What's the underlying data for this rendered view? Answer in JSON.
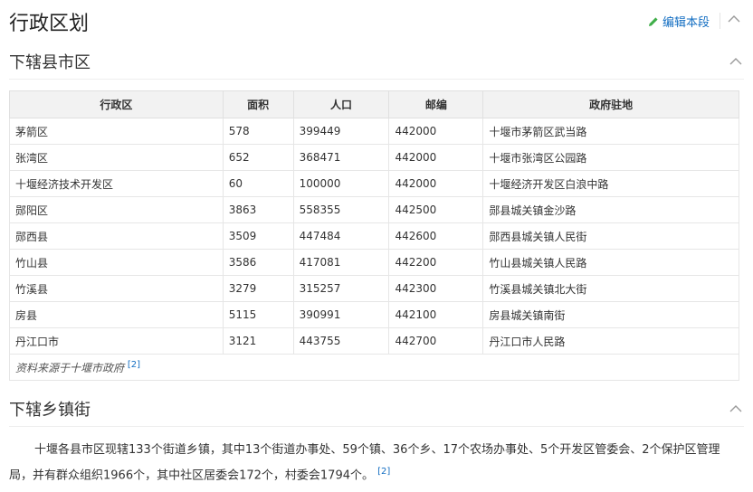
{
  "header": {
    "title": "行政区划",
    "edit_label": "编辑本段"
  },
  "section1": {
    "title": "下辖县市区"
  },
  "table": {
    "headers": [
      "行政区",
      "面积",
      "人口",
      "邮编",
      "政府驻地"
    ],
    "rows": [
      [
        "茅箭区",
        "578",
        "399449",
        "442000",
        "十堰市茅箭区武当路"
      ],
      [
        "张湾区",
        "652",
        "368471",
        "442000",
        "十堰市张湾区公园路"
      ],
      [
        "十堰经济技术开发区",
        "60",
        "100000",
        "442000",
        "十堰经济开发区白浪中路"
      ],
      [
        "郧阳区",
        "3863",
        "558355",
        "442500",
        "郧县城关镇金沙路"
      ],
      [
        "郧西县",
        "3509",
        "447484",
        "442600",
        "郧西县城关镇人民街"
      ],
      [
        "竹山县",
        "3586",
        "417081",
        "442200",
        "竹山县城关镇人民路"
      ],
      [
        "竹溪县",
        "3279",
        "315257",
        "442300",
        "竹溪县城关镇北大街"
      ],
      [
        "房县",
        "5115",
        "390991",
        "442100",
        "房县城关镇南街"
      ],
      [
        "丹江口市",
        "3121",
        "443755",
        "442700",
        "丹江口市人民路"
      ]
    ],
    "source_text": "资料来源于十堰市政府",
    "source_ref": "[2]"
  },
  "section2": {
    "title": "下辖乡镇街",
    "paragraph": "十堰各县市区现辖133个街道乡镇，其中13个街道办事处、59个镇、36个乡、17个农场办事处、5个开发区管委会、2个保护区管理局，并有群众组织1966个，其中社区居委会172个，村委会1794个。",
    "ref": "[2]"
  },
  "icons": {
    "edit": "pencil-icon",
    "collapse": "chevron-up-icon"
  },
  "colors": {
    "link": "#136ec2",
    "edit_icon": "#3fae49",
    "header_bg": "#f2f2f2"
  }
}
